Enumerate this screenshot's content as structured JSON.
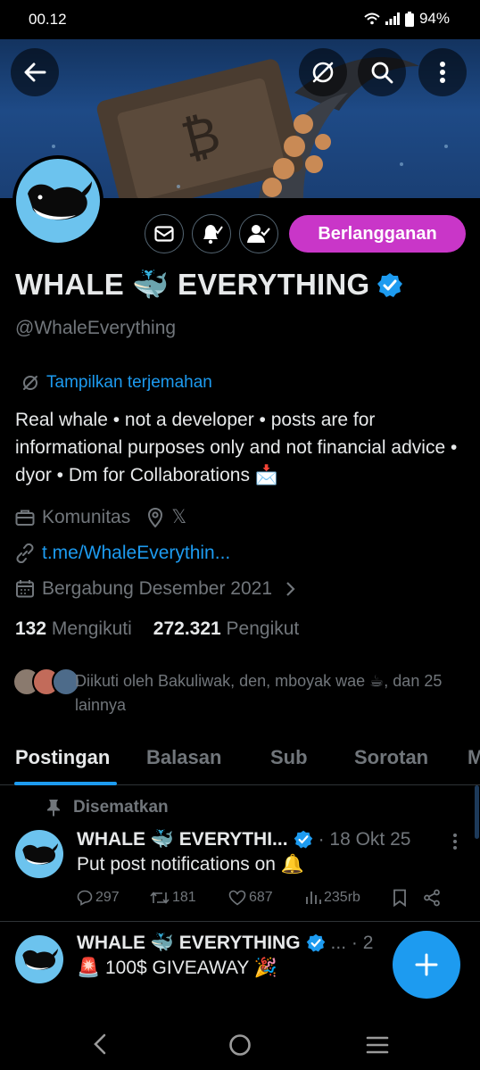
{
  "status_bar": {
    "time": "00.12",
    "battery": "94%"
  },
  "profile": {
    "display_name": "WHALE 🐳 EVERYTHING",
    "handle": "@WhaleEverything",
    "subscribe_label": "Berlangganan",
    "translate_label": "Tampilkan terjemahan",
    "bio": "Real whale • not a developer • posts are for informational purposes only and not financial advice • dyor • Dm for Collaborations 📩",
    "category": "Komunitas",
    "location": "𝕏",
    "website": "t.me/WhaleEverythin...",
    "joined": "Bergabung Desember 2021",
    "following_count": "132",
    "following_label": "Mengikuti",
    "followers_count": "272.321",
    "followers_label": "Pengikut",
    "followed_by": "Diikuti oleh Bakuliwak, den, mboyak wae ☕, dan 25 lainnya"
  },
  "tabs": [
    "Postingan",
    "Balasan",
    "Sub",
    "Sorotan",
    "M"
  ],
  "posts": [
    {
      "pinned_label": "Disematkan",
      "author": "WHALE 🐳 EVERYTHI...",
      "date": "· 18 Okt 25",
      "text": "Put post notifications on 🔔",
      "replies": "297",
      "reposts": "181",
      "likes": "687",
      "views": "235rb"
    },
    {
      "author": "WHALE 🐳 EVERYTHING",
      "date": "... · 2",
      "text": "🚨 100$ GIVEAWAY 🎉"
    }
  ],
  "colors": {
    "accent": "#1d9bf0",
    "subscribe": "#c936c8",
    "verified": "#1d9bf0",
    "muted": "#71767b"
  }
}
